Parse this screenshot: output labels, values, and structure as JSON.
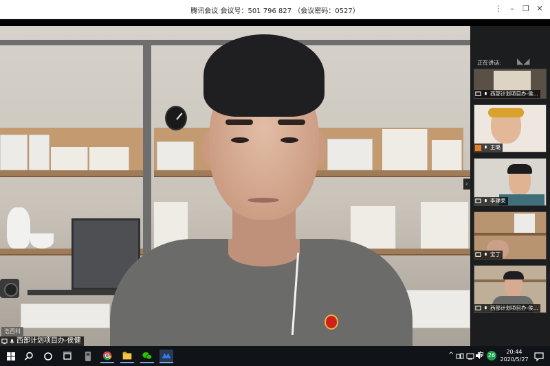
{
  "window": {
    "title": "腾讯会议  会议号：501 796 827  （会议密码：0527）",
    "controls": [
      "⋮",
      "–",
      "❐",
      "✕"
    ]
  },
  "main_video": {
    "speaker_label": "西部计划项目办-侯健",
    "wall_label": "浩西科"
  },
  "sidebar": {
    "speaking_label": "正在讲话:",
    "tiles": [
      {
        "label": "西部计划项目办-侯..."
      },
      {
        "label": "王璐"
      },
      {
        "label": "李建荣"
      },
      {
        "label": "宝丁"
      },
      {
        "label": "西部计划项目办-侯..."
      }
    ]
  },
  "taskbar": {
    "apps": [
      "windows-start",
      "search",
      "cortana",
      "task-view",
      "usb-app",
      "chrome",
      "file-explorer",
      "wechat",
      "tencent-meeting"
    ],
    "tray": {
      "chevron": "^",
      "ime": "中",
      "badge_count": "26"
    },
    "time": "20:44",
    "date": "2020/5/27"
  },
  "colors": {
    "accent": "#2f7cf6",
    "badge_green": "#1a9c4b",
    "taskbar_bg": "#101418",
    "sidebar_bg": "#1c1d1f"
  }
}
